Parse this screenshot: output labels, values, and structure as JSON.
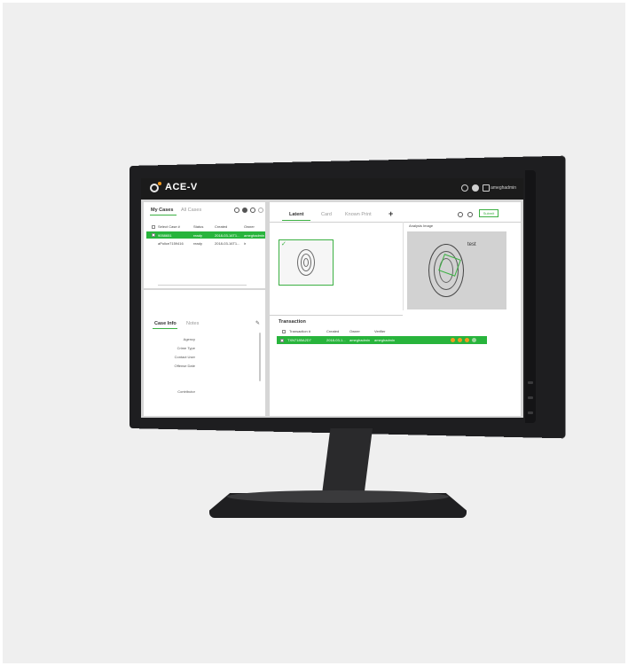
{
  "app": {
    "title": "ACE-V",
    "user": "ameghadmin",
    "accent_color": "#28b43c",
    "topbar_icons": [
      "help-icon",
      "settings-icon",
      "logout-icon"
    ]
  },
  "cases_panel": {
    "tabs": [
      "My Cases",
      "All Cases"
    ],
    "header_icons": [
      "circle-icon",
      "circle-icon",
      "circle-icon",
      "circle-icon"
    ],
    "columns": [
      "Select Case #",
      "Status",
      "Created",
      "Owner"
    ],
    "rows": [
      {
        "case": "9058651",
        "status": "ready",
        "created": "2018-03-16T1...",
        "owner": "ameghadmin",
        "selected": true
      },
      {
        "case": "aPolice7159416",
        "status": "ready",
        "created": "2018-03-16T1...",
        "owner": "ir",
        "selected": false
      }
    ]
  },
  "info_panel": {
    "tabs": [
      "Case Info",
      "Notes"
    ],
    "fields": [
      "Agency",
      "Crime Type",
      "Contact User",
      "Offense Date",
      "Contributor"
    ]
  },
  "evidence_panel": {
    "tabs": [
      "Latent",
      "Card",
      "Known Print"
    ],
    "add_label": "+",
    "action_button": "Submit",
    "analysis_label": "Analysis Image",
    "analysis_text": "test"
  },
  "transaction_panel": {
    "title": "Transaction",
    "columns": [
      "Transaction #",
      "Created",
      "Owner",
      "Verifier"
    ],
    "row": {
      "id": "TXN7185A2D7",
      "created": "2018-03-1...",
      "owner": "ameghadmin",
      "verifier": "ameghadmin"
    }
  }
}
